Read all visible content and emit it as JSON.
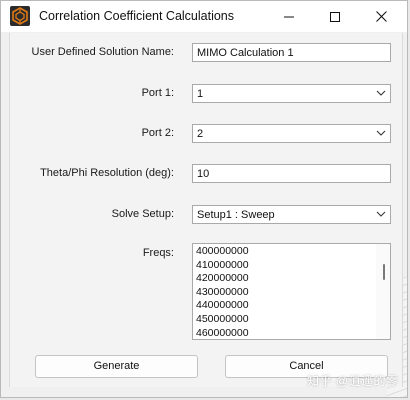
{
  "window": {
    "title": "Correlation Coefficient Calculations",
    "icon": "ansys-hfss-icon",
    "controls": [
      "minimize-icon",
      "maximize-icon",
      "close-icon"
    ]
  },
  "form": {
    "solution_name": {
      "label": "User Defined Solution Name:",
      "value": "MIMO Calculation 1"
    },
    "port1": {
      "label": "Port 1:",
      "value": "1"
    },
    "port2": {
      "label": "Port 2:",
      "value": "2"
    },
    "resolution": {
      "label": "Theta/Phi Resolution (deg):",
      "value": "10"
    },
    "solve_setup": {
      "label": "Solve Setup:",
      "value": "Setup1 : Sweep"
    },
    "freqs": {
      "label": "Freqs:",
      "items": [
        "400000000",
        "410000000",
        "420000000",
        "430000000",
        "440000000",
        "450000000",
        "460000000"
      ]
    }
  },
  "buttons": {
    "generate": "Generate",
    "cancel": "Cancel"
  },
  "watermark": "知乎 @逍遥的零",
  "colors": {
    "window_bg": "#f0f0f0",
    "titlebar_bg": "#ffffff",
    "field_border": "#a9a9a9",
    "icon_orange": "#e07b17"
  }
}
